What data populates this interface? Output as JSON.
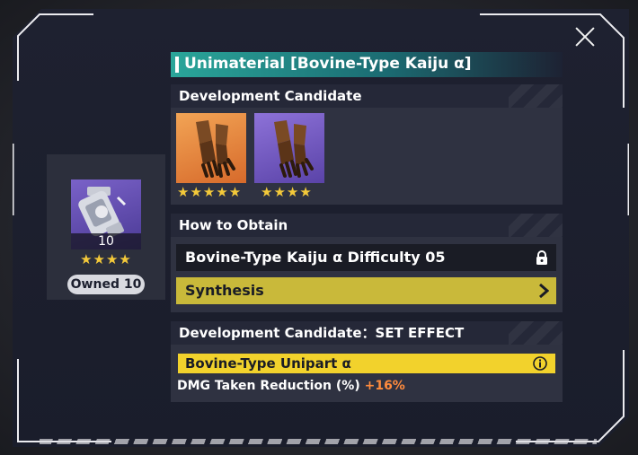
{
  "title": "Unimaterial [Bovine-Type Kaiju α]",
  "item": {
    "count": "10",
    "stars": "★★★★",
    "owned_label": "Owned 10"
  },
  "development": {
    "heading": "Development Candidate",
    "candidates": [
      {
        "stars": "★★★★★",
        "bg": "orange",
        "icon": "gauntlet-icon"
      },
      {
        "stars": "★★★★",
        "bg": "purple",
        "icon": "gauntlet-icon"
      }
    ]
  },
  "obtain": {
    "heading": "How to Obtain",
    "rows": [
      {
        "label": "Bovine-Type Kaiju α Difficulty 05",
        "icon": "lock-icon",
        "locked": true
      },
      {
        "label": "Synthesis",
        "icon": "chevron-right-icon"
      }
    ]
  },
  "set_effect": {
    "heading": "Development Candidate：SET EFFECT",
    "set_name": "Bovine-Type Unipart α",
    "effect_label": "DMG Taken Reduction (%)",
    "effect_value": "+16%"
  },
  "colors": {
    "accent_teal": "#2aa69a",
    "synthesis_yellow": "#c9b93a",
    "set_yellow": "#f2d22c",
    "star": "#f3c93a",
    "effect_orange": "#ff8b3d"
  }
}
